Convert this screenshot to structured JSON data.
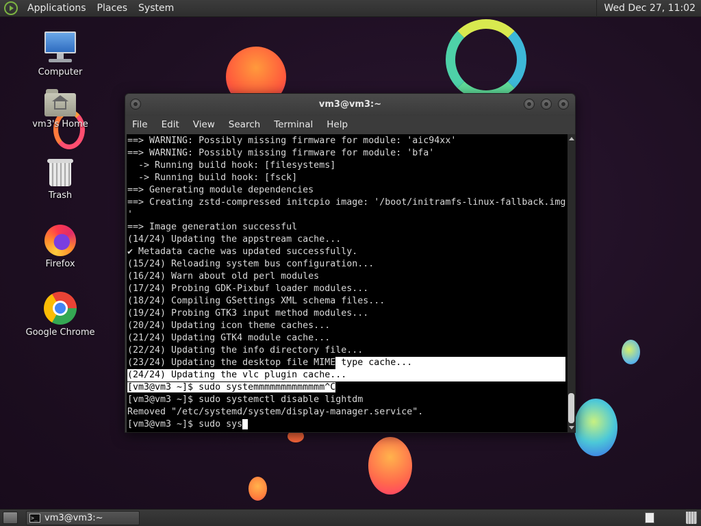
{
  "top_panel": {
    "menus": [
      "Applications",
      "Places",
      "System"
    ],
    "clock": "Wed Dec 27, 11:02"
  },
  "desktop_icons": {
    "computer": "Computer",
    "home": "vm3's Home",
    "trash": "Trash",
    "firefox": "Firefox",
    "chrome": "Google Chrome"
  },
  "terminal": {
    "title": "vm3@vm3:~",
    "menu": [
      "File",
      "Edit",
      "View",
      "Search",
      "Terminal",
      "Help"
    ],
    "lines": [
      "==> WARNING: Possibly missing firmware for module: 'aic94xx'",
      "==> WARNING: Possibly missing firmware for module: 'bfa'",
      "  -> Running build hook: [filesystems]",
      "  -> Running build hook: [fsck]",
      "==> Generating module dependencies",
      "==> Creating zstd-compressed initcpio image: '/boot/initramfs-linux-fallback.img",
      "'",
      "==> Image generation successful",
      "(14/24) Updating the appstream cache...",
      "✔ Metadata cache was updated successfully.",
      "(15/24) Reloading system bus configuration...",
      "(16/24) Warn about old perl modules",
      "(17/24) Probing GDK-Pixbuf loader modules...",
      "(18/24) Compiling GSettings XML schema files...",
      "(19/24) Probing GTK3 input method modules...",
      "(20/24) Updating icon theme caches...",
      "(21/24) Updating GTK4 module cache...",
      "(22/24) Updating the info directory file...",
      "(23/24) Updating the desktop file MIME",
      " type cache...",
      "(24/24) Updating the vlc plugin cache...",
      "[vm3@vm3 ~]$ sudo systemmmmmmmmmmmmm^C",
      "[vm3@vm3 ~]$ sudo systemctl disable lightdm",
      "Removed \"/etc/systemd/system/display-manager.service\".",
      "[vm3@vm3 ~]$ sudo sys"
    ]
  },
  "bottom_panel": {
    "task_label": "vm3@vm3:~",
    "term_glyph": ">_"
  },
  "colors": {
    "terminal_bg": "#000000",
    "terminal_fg": "#d8d8d8",
    "panel_bg": "#333333"
  }
}
